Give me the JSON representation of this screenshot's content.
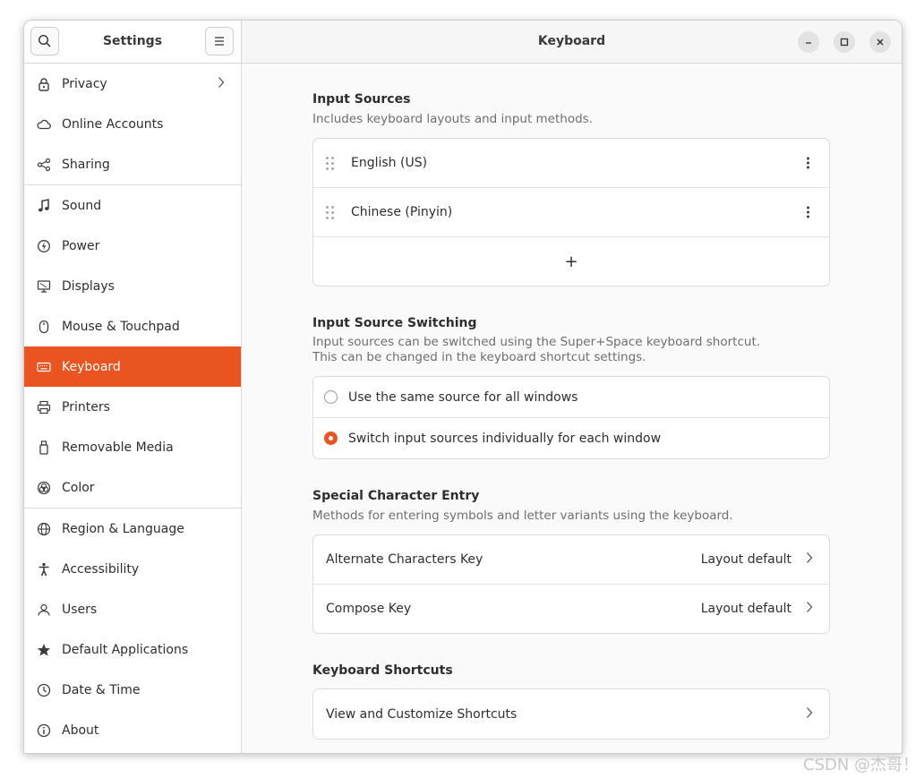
{
  "sidebar": {
    "title": "Settings",
    "groups": [
      [
        {
          "label": "Privacy",
          "icon": "lock-icon",
          "chevron": true
        },
        {
          "label": "Online Accounts",
          "icon": "cloud-icon"
        },
        {
          "label": "Sharing",
          "icon": "share-icon"
        }
      ],
      [
        {
          "label": "Sound",
          "icon": "music-note-icon"
        },
        {
          "label": "Power",
          "icon": "power-icon"
        },
        {
          "label": "Displays",
          "icon": "display-icon"
        },
        {
          "label": "Mouse & Touchpad",
          "icon": "mouse-icon"
        },
        {
          "label": "Keyboard",
          "icon": "keyboard-icon",
          "active": true
        },
        {
          "label": "Printers",
          "icon": "printer-icon"
        },
        {
          "label": "Removable Media",
          "icon": "usb-icon"
        },
        {
          "label": "Color",
          "icon": "color-icon"
        }
      ],
      [
        {
          "label": "Region & Language",
          "icon": "globe-icon"
        },
        {
          "label": "Accessibility",
          "icon": "accessibility-icon"
        },
        {
          "label": "Users",
          "icon": "users-icon"
        },
        {
          "label": "Default Applications",
          "icon": "star-icon"
        },
        {
          "label": "Date & Time",
          "icon": "clock-icon"
        },
        {
          "label": "About",
          "icon": "info-icon"
        }
      ]
    ]
  },
  "header": {
    "title": "Keyboard"
  },
  "input_sources": {
    "title": "Input Sources",
    "description": "Includes keyboard layouts and input methods.",
    "items": [
      "English (US)",
      "Chinese (Pinyin)"
    ],
    "add_label": "+"
  },
  "switching": {
    "title": "Input Source Switching",
    "description_1": "Input sources can be switched using the Super+Space keyboard shortcut.",
    "description_2": "This can be changed in the keyboard shortcut settings.",
    "options": [
      {
        "label": "Use the same source for all windows",
        "selected": false
      },
      {
        "label": "Switch input sources individually for each window",
        "selected": true
      }
    ]
  },
  "special": {
    "title": "Special Character Entry",
    "description": "Methods for entering symbols and letter variants using the keyboard.",
    "rows": [
      {
        "label": "Alternate Characters Key",
        "value": "Layout default"
      },
      {
        "label": "Compose Key",
        "value": "Layout default"
      }
    ]
  },
  "shortcuts": {
    "title": "Keyboard Shortcuts",
    "row_label": "View and Customize Shortcuts"
  },
  "watermark": "CSDN @杰哥！",
  "colors": {
    "accent": "#e95420"
  }
}
